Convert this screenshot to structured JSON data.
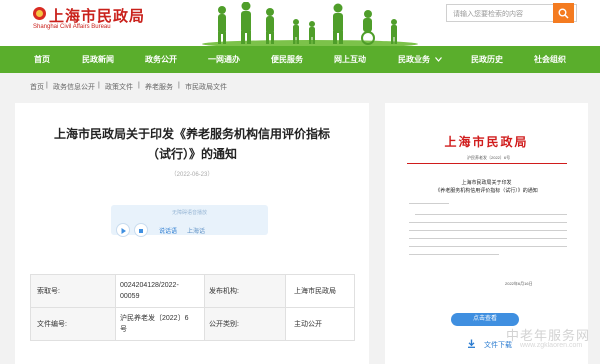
{
  "header": {
    "logo_title": "上海市民政局",
    "logo_subtitle": "Shanghai Civil Affairs Bureau",
    "search_placeholder": "请输入您要检索的内容"
  },
  "nav": [
    "首页",
    "民政新闻",
    "政务公开",
    "一网通办",
    "便民服务",
    "网上互动",
    "民政业务",
    "民政历史",
    "社会组织"
  ],
  "breadcrumb": [
    "首页",
    "政务信息公开",
    "政策文件",
    "养老服务",
    "市民政局文件"
  ],
  "article": {
    "title_line1": "上海市民政局关于印发《养老服务机构信用评价指标",
    "title_line2": "（试行）》的通知",
    "date": "（2022-06-23）",
    "player_caption": "无障碍语音播放",
    "player_read": "说话语",
    "player_city": "上海话"
  },
  "info_table": [
    {
      "label1": "索取号:",
      "value1_line1": "0024204128/2022-",
      "value1_line2": "00059",
      "label2": "发布机构:",
      "value2": "上海市民政局"
    },
    {
      "label1": "文件编号:",
      "value1_line1": "沪民养老发〔2022〕6",
      "value1_line2": "号",
      "label2": "公开类别:",
      "value2": "主动公开"
    }
  ],
  "doc_preview": {
    "header": "上海市民政局",
    "doc_number": "沪民养老发〔2022〕6号",
    "doc_title_line1": "上海市民政局关于印发",
    "doc_title_line2": "《养老服务机构信用评价指标（试行）》的通知",
    "doc_date": "2022年6月16日",
    "view_button": "点击查看",
    "download_label": "文件下载"
  },
  "watermark": {
    "line1": "中老年服务网",
    "line2": "www.zgklaoren.com"
  },
  "colors": {
    "nav_green": "#5aae2c",
    "brand_red": "#c9201b",
    "accent_orange": "#f47b20",
    "link_blue": "#2a7bd0"
  }
}
